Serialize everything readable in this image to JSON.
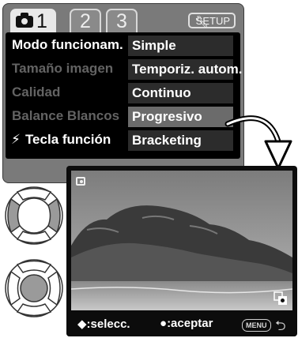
{
  "menu": {
    "tabs": [
      {
        "label": "1"
      },
      {
        "label": "2"
      },
      {
        "label": "3"
      }
    ],
    "setup_label": "SETUP",
    "rows": [
      {
        "label": "Modo funcionam.",
        "option": "Simple"
      },
      {
        "label": "Tamaño imagen",
        "option": "Temporiz. autom."
      },
      {
        "label": "Calidad",
        "option": "Continuo"
      },
      {
        "label": "Balance Blancos",
        "option": "Progresivo"
      },
      {
        "label": "Tecla función",
        "option": "Bracketing"
      }
    ],
    "flash_glyph": "⚡"
  },
  "playback": {
    "select_label": ":selecc.",
    "accept_label": ":aceptar",
    "menu_button": "MENU",
    "select_glyph": "◆",
    "accept_glyph": "●",
    "back_glyph": "⮌"
  },
  "colors": {
    "menu_bg": "#7a7a7a",
    "panel_bg": "#000000",
    "option_bg": "#2c2c2c",
    "selected_option_bg": "#6b6b6b",
    "active_text": "#ffffff",
    "inactive_text": "#636363"
  }
}
